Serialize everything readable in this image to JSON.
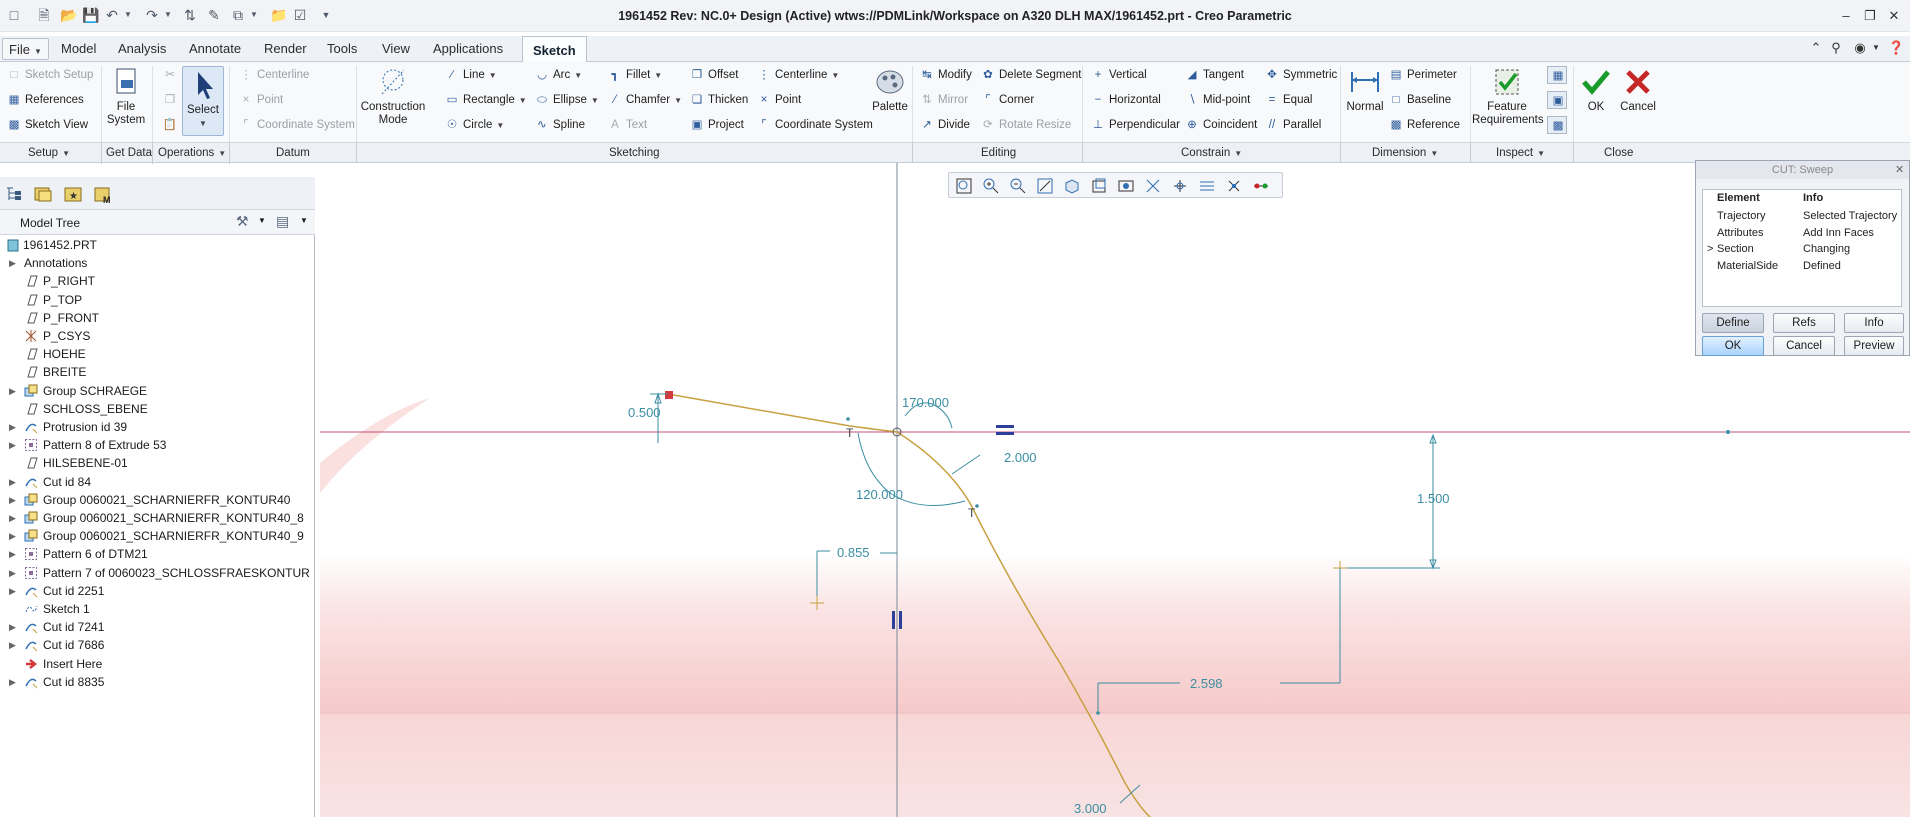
{
  "window": {
    "title": "1961452 Rev: NC.0+ Design  (Active) wtws://PDMLink/Workspace on A320 DLH MAX/1961452.prt - Creo Parametric"
  },
  "tabs": [
    {
      "label": "File"
    },
    {
      "label": "Model"
    },
    {
      "label": "Analysis"
    },
    {
      "label": "Annotate"
    },
    {
      "label": "Render"
    },
    {
      "label": "Tools"
    },
    {
      "label": "View"
    },
    {
      "label": "Applications"
    },
    {
      "label": "Sketch"
    }
  ],
  "ribbon": {
    "setup": {
      "sketch_setup": "Sketch Setup",
      "references": "References",
      "sketch_view": "Sketch View"
    },
    "get_data": {
      "file_system": "File System"
    },
    "operations": {
      "select": "Select"
    },
    "datum": {
      "centerline": "Centerline",
      "point": "Point",
      "coordinate_system": "Coordinate System"
    },
    "sketching": {
      "construction_mode": "Construction Mode",
      "line": "Line",
      "rectangle": "Rectangle",
      "circle": "Circle",
      "arc": "Arc",
      "ellipse": "Ellipse",
      "spline": "Spline",
      "fillet": "Fillet",
      "chamfer": "Chamfer",
      "text": "Text",
      "offset": "Offset",
      "thicken": "Thicken",
      "project": "Project",
      "centerline": "Centerline",
      "point": "Point",
      "coordinate_system": "Coordinate System",
      "palette": "Palette"
    },
    "editing": {
      "modify": "Modify",
      "mirror": "Mirror",
      "divide": "Divide",
      "delete_segment": "Delete Segment",
      "corner": "Corner",
      "rotate_resize": "Rotate Resize"
    },
    "constrain": {
      "vertical": "Vertical",
      "horizontal": "Horizontal",
      "perpendicular": "Perpendicular",
      "tangent": "Tangent",
      "mid_point": "Mid-point",
      "coincident": "Coincident",
      "symmetric": "Symmetric",
      "equal": "Equal",
      "parallel": "Parallel"
    },
    "dimension": {
      "normal": "Normal",
      "perimeter": "Perimeter",
      "baseline": "Baseline",
      "reference": "Reference"
    },
    "inspect": {
      "feature_requirements": "Feature Requirements"
    },
    "close": {
      "ok": "OK",
      "cancel": "Cancel"
    }
  },
  "groups": {
    "setup": "Setup",
    "get_data": "Get Data",
    "operations": "Operations",
    "datum": "Datum",
    "sketching": "Sketching",
    "editing": "Editing",
    "constrain": "Constrain",
    "dimension": "Dimension",
    "inspect": "Inspect",
    "close": "Close"
  },
  "model_tree": {
    "header": "Model Tree",
    "items": [
      {
        "label": "1961452.PRT",
        "expandable": false,
        "icon": "part-icon"
      },
      {
        "label": "Annotations",
        "expandable": true,
        "icon": ""
      },
      {
        "label": "P_RIGHT",
        "expandable": false,
        "icon": "datum-plane-icon"
      },
      {
        "label": "P_TOP",
        "expandable": false,
        "icon": "datum-plane-icon"
      },
      {
        "label": "P_FRONT",
        "expandable": false,
        "icon": "datum-plane-icon"
      },
      {
        "label": "P_CSYS",
        "expandable": false,
        "icon": "csys-icon"
      },
      {
        "label": "HOEHE",
        "expandable": false,
        "icon": "datum-plane-icon"
      },
      {
        "label": "BREITE",
        "expandable": false,
        "icon": "datum-plane-icon"
      },
      {
        "label": "Group SCHRAEGE",
        "expandable": true,
        "icon": "group-icon"
      },
      {
        "label": "SCHLOSS_EBENE",
        "expandable": false,
        "icon": "datum-plane-icon"
      },
      {
        "label": "Protrusion id 39",
        "expandable": true,
        "icon": "protrusion-icon"
      },
      {
        "label": "Pattern 8 of Extrude 53",
        "expandable": true,
        "icon": "pattern-icon"
      },
      {
        "label": "HILSEBENE-01",
        "expandable": false,
        "icon": "datum-plane-icon"
      },
      {
        "label": "Cut id 84",
        "expandable": true,
        "icon": "cut-icon"
      },
      {
        "label": "Group 0060021_SCHARNIERFR_KONTUR40",
        "expandable": true,
        "icon": "group-icon"
      },
      {
        "label": "Group 0060021_SCHARNIERFR_KONTUR40_8",
        "expandable": true,
        "icon": "group-icon"
      },
      {
        "label": "Group 0060021_SCHARNIERFR_KONTUR40_9",
        "expandable": true,
        "icon": "group-icon"
      },
      {
        "label": "Pattern 6 of DTM21",
        "expandable": true,
        "icon": "pattern-icon"
      },
      {
        "label": "Pattern 7 of 0060023_SCHLOSSFRAESKONTUR",
        "expandable": true,
        "icon": "pattern-icon"
      },
      {
        "label": "Cut id 2251",
        "expandable": true,
        "icon": "cut-icon"
      },
      {
        "label": "Sketch 1",
        "expandable": false,
        "icon": "sketch-icon"
      },
      {
        "label": "Cut id 7241",
        "expandable": true,
        "icon": "cut-icon"
      },
      {
        "label": "Cut id 7686",
        "expandable": true,
        "icon": "cut-icon"
      },
      {
        "label": "Insert Here",
        "expandable": false,
        "icon": "insert-arrow-icon"
      },
      {
        "label": "Cut id 8835",
        "expandable": true,
        "icon": "cut-icon"
      }
    ]
  },
  "sweep_dialog": {
    "title": "CUT: Sweep",
    "col_element": "Element",
    "col_info": "Info",
    "rows": [
      {
        "marker": "",
        "element": "Trajectory",
        "info": "Selected Trajectory"
      },
      {
        "marker": "",
        "element": "Attributes",
        "info": "Add Inn Faces"
      },
      {
        "marker": ">",
        "element": "Section",
        "info": "Changing"
      },
      {
        "marker": "",
        "element": "MaterialSide",
        "info": "Defined"
      }
    ],
    "define": "Define",
    "refs": "Refs",
    "info": "Info",
    "ok": "OK",
    "cancel": "Cancel",
    "preview": "Preview"
  },
  "sketch": {
    "dim_0500": "0.500",
    "dim_170": "170.000",
    "dim_2000": "2.000",
    "dim_120": "120.000",
    "dim_0855": "0.855",
    "dim_1500": "1.500",
    "dim_2598": "2.598",
    "dim_3000": "3.000",
    "tangent_1": "T",
    "tangent_2": "T"
  },
  "colors": {
    "accent": "#2f6fb3",
    "dimension": "#3b8ea3",
    "curve": "#c8a040",
    "datum": "#c0507a",
    "ok_green": "#1a9c2c",
    "cancel_red": "#c62828"
  }
}
